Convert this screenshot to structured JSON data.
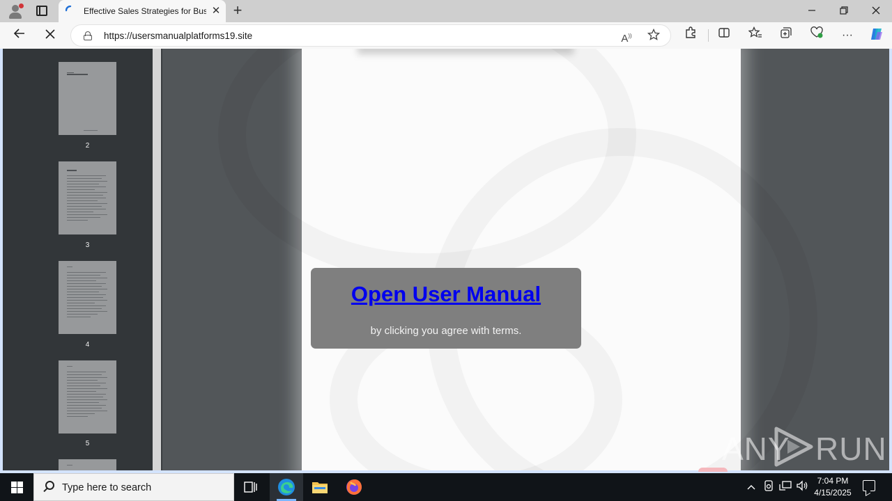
{
  "browser": {
    "tab_title": "Effective Sales Strategies for Busi",
    "new_tab_label": "+",
    "close_tab_label": "✕",
    "url": "https://usersmanualplatforms19.site"
  },
  "sidebar": {
    "thumbnails": [
      {
        "page": "2"
      },
      {
        "page": "3"
      },
      {
        "page": "4"
      },
      {
        "page": "5"
      }
    ]
  },
  "modal": {
    "link_text": "Open User Manual",
    "subtext": "by clicking you agree with terms."
  },
  "watermark": {
    "left": "ANY",
    "right": "RUN"
  },
  "taskbar": {
    "search_placeholder": "Type here to search",
    "time": "7:04 PM",
    "date": "4/15/2025"
  },
  "icons": {
    "browser_favicon": "edge-loading-icon",
    "accent": "#1f6fd6",
    "link_color": "#0000ee"
  }
}
